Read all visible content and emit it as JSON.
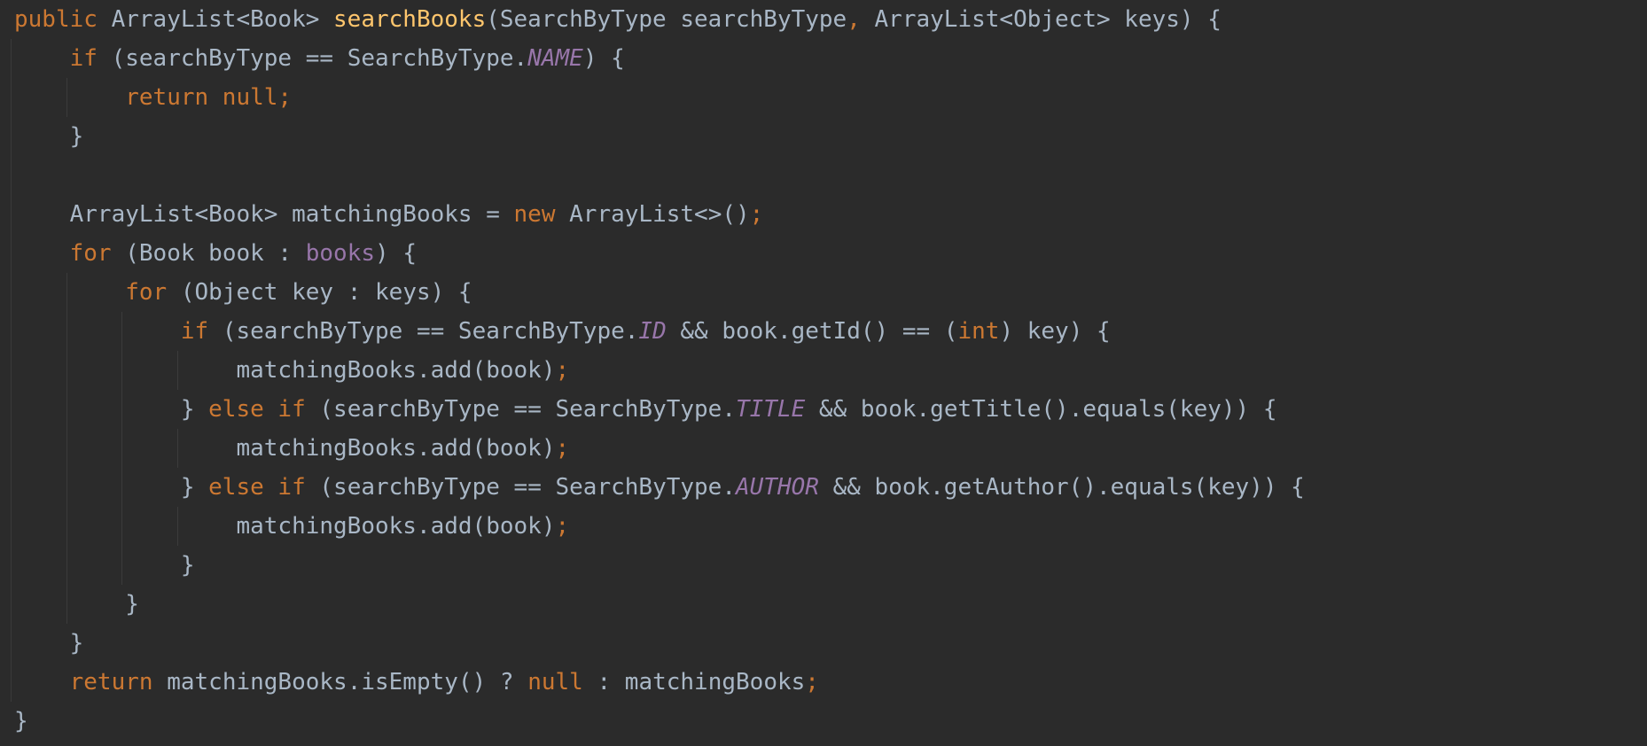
{
  "editor": {
    "language": "Java",
    "colors": {
      "background": "#2b2b2b",
      "text": "#a9b7c6",
      "keyword": "#cc7832",
      "function": "#ffc66d",
      "constant": "#9876aa",
      "field": "#9876aa",
      "indent_guide": "#3b3b3b"
    },
    "lines": [
      {
        "indent": 0,
        "tokens": [
          {
            "t": "public ",
            "c": "kw"
          },
          {
            "t": "ArrayList<Book> ",
            "c": "txt"
          },
          {
            "t": "searchBooks",
            "c": "fn"
          },
          {
            "t": "(SearchByType searchByType",
            "c": "txt"
          },
          {
            "t": ", ",
            "c": "kw"
          },
          {
            "t": "ArrayList<Object> keys) {",
            "c": "txt"
          }
        ]
      },
      {
        "indent": 1,
        "tokens": [
          {
            "t": "if ",
            "c": "kw"
          },
          {
            "t": "(searchByType == SearchByType.",
            "c": "txt"
          },
          {
            "t": "NAME",
            "c": "en"
          },
          {
            "t": ") {",
            "c": "txt"
          }
        ]
      },
      {
        "indent": 2,
        "tokens": [
          {
            "t": "return null;",
            "c": "kw"
          }
        ]
      },
      {
        "indent": 1,
        "tokens": [
          {
            "t": "}",
            "c": "txt"
          }
        ]
      },
      {
        "indent": 0,
        "tokens": []
      },
      {
        "indent": 1,
        "tokens": [
          {
            "t": "ArrayList<Book> matchingBooks = ",
            "c": "txt"
          },
          {
            "t": "new ",
            "c": "kw"
          },
          {
            "t": "ArrayList<>()",
            "c": "txt"
          },
          {
            "t": ";",
            "c": "kw"
          }
        ]
      },
      {
        "indent": 1,
        "tokens": [
          {
            "t": "for ",
            "c": "kw"
          },
          {
            "t": "(Book book : ",
            "c": "txt"
          },
          {
            "t": "books",
            "c": "fld"
          },
          {
            "t": ") {",
            "c": "txt"
          }
        ]
      },
      {
        "indent": 2,
        "tokens": [
          {
            "t": "for ",
            "c": "kw"
          },
          {
            "t": "(Object key : keys) {",
            "c": "txt"
          }
        ]
      },
      {
        "indent": 3,
        "tokens": [
          {
            "t": "if ",
            "c": "kw"
          },
          {
            "t": "(searchByType == SearchByType.",
            "c": "txt"
          },
          {
            "t": "ID",
            "c": "en"
          },
          {
            "t": " && book.getId() == (",
            "c": "txt"
          },
          {
            "t": "int",
            "c": "kw"
          },
          {
            "t": ") key) {",
            "c": "txt"
          }
        ]
      },
      {
        "indent": 4,
        "tokens": [
          {
            "t": "matchingBooks.add(book)",
            "c": "txt"
          },
          {
            "t": ";",
            "c": "kw"
          }
        ]
      },
      {
        "indent": 3,
        "tokens": [
          {
            "t": "} ",
            "c": "txt"
          },
          {
            "t": "else if ",
            "c": "kw"
          },
          {
            "t": "(searchByType == SearchByType.",
            "c": "txt"
          },
          {
            "t": "TITLE",
            "c": "en"
          },
          {
            "t": " && book.getTitle().equals(key)) {",
            "c": "txt"
          }
        ]
      },
      {
        "indent": 4,
        "tokens": [
          {
            "t": "matchingBooks.add(book)",
            "c": "txt"
          },
          {
            "t": ";",
            "c": "kw"
          }
        ]
      },
      {
        "indent": 3,
        "tokens": [
          {
            "t": "} ",
            "c": "txt"
          },
          {
            "t": "else if ",
            "c": "kw"
          },
          {
            "t": "(searchByType == SearchByType.",
            "c": "txt"
          },
          {
            "t": "AUTHOR",
            "c": "en"
          },
          {
            "t": " && book.getAuthor().equals(key)) {",
            "c": "txt"
          }
        ]
      },
      {
        "indent": 4,
        "tokens": [
          {
            "t": "matchingBooks.add(book)",
            "c": "txt"
          },
          {
            "t": ";",
            "c": "kw"
          }
        ]
      },
      {
        "indent": 3,
        "tokens": [
          {
            "t": "}",
            "c": "txt"
          }
        ]
      },
      {
        "indent": 2,
        "tokens": [
          {
            "t": "}",
            "c": "txt"
          }
        ]
      },
      {
        "indent": 1,
        "tokens": [
          {
            "t": "}",
            "c": "txt"
          }
        ]
      },
      {
        "indent": 1,
        "tokens": [
          {
            "t": "return ",
            "c": "kw"
          },
          {
            "t": "matchingBooks.isEmpty() ? ",
            "c": "txt"
          },
          {
            "t": "null ",
            "c": "kw"
          },
          {
            "t": ": matchingBooks",
            "c": "txt"
          },
          {
            "t": ";",
            "c": "kw"
          }
        ]
      },
      {
        "indent": 0,
        "tokens": [
          {
            "t": "}",
            "c": "txt"
          }
        ]
      }
    ]
  }
}
